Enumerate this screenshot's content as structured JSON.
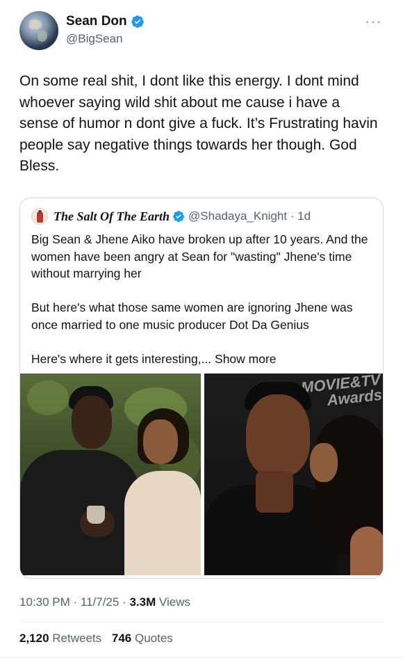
{
  "author": {
    "display_name": "Sean Don",
    "handle": "@BigSean",
    "avatar_icon": "earth-avatar",
    "verified_icon": "verified-badge-icon"
  },
  "menu_icon": "more-options-icon",
  "tweet_text": "On some real shit, I dont like this energy. I dont mind whoever saying wild shit about me cause i have a sense of humor n dont give a fuck. It’s Frustrating havin people say negative things towards her though. God Bless.",
  "quoted_tweet": {
    "display_name": "The Salt Of The Earth",
    "handle": "@Shadaya_Knight",
    "time_ago": "1d",
    "text": "Big Sean & Jhene Aiko have broken up after 10 years. And the women have been angry at Sean for \"wasting\" Jhene's time without marrying her\n\nBut here's what those same women are ignoring Jhene was once married to one music producer Dot Da Genius\n\nHere's where it gets interesting,... ",
    "show_more": "Show more",
    "image_left_overlay": "",
    "image_right_overlay": "MOVIE&TV Awards"
  },
  "timestamp": {
    "time": "10:30 PM",
    "date": "11/7/25",
    "views_count": "3.3M",
    "views_label": "Views"
  },
  "stats": {
    "retweets_count": "2,120",
    "retweets_label": "Retweets",
    "quotes_count": "746",
    "quotes_label": "Quotes"
  },
  "colors": {
    "verified_blue": "#1d9bf0",
    "secondary_text": "#536471",
    "primary_text": "#0f1419",
    "border": "#cfd9de"
  }
}
